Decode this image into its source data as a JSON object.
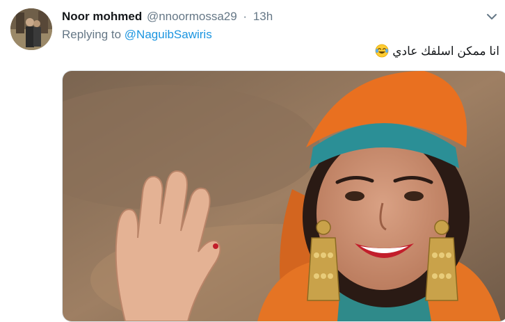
{
  "tweet": {
    "author_name": "Noor mohmed",
    "handle": "@nnoormossa29",
    "separator": "·",
    "time": "13h",
    "reply_prefix": "Replying to",
    "reply_to": "@NaguibSawiris",
    "text": "انا ممكن اسلفك عادي",
    "emoji": "face-with-tears-of-joy",
    "caret_icon": "chevron-down-icon"
  },
  "colors": {
    "name": "#14171a",
    "meta": "#657786",
    "link": "#1b95e0",
    "border": "#e1e8ed"
  }
}
